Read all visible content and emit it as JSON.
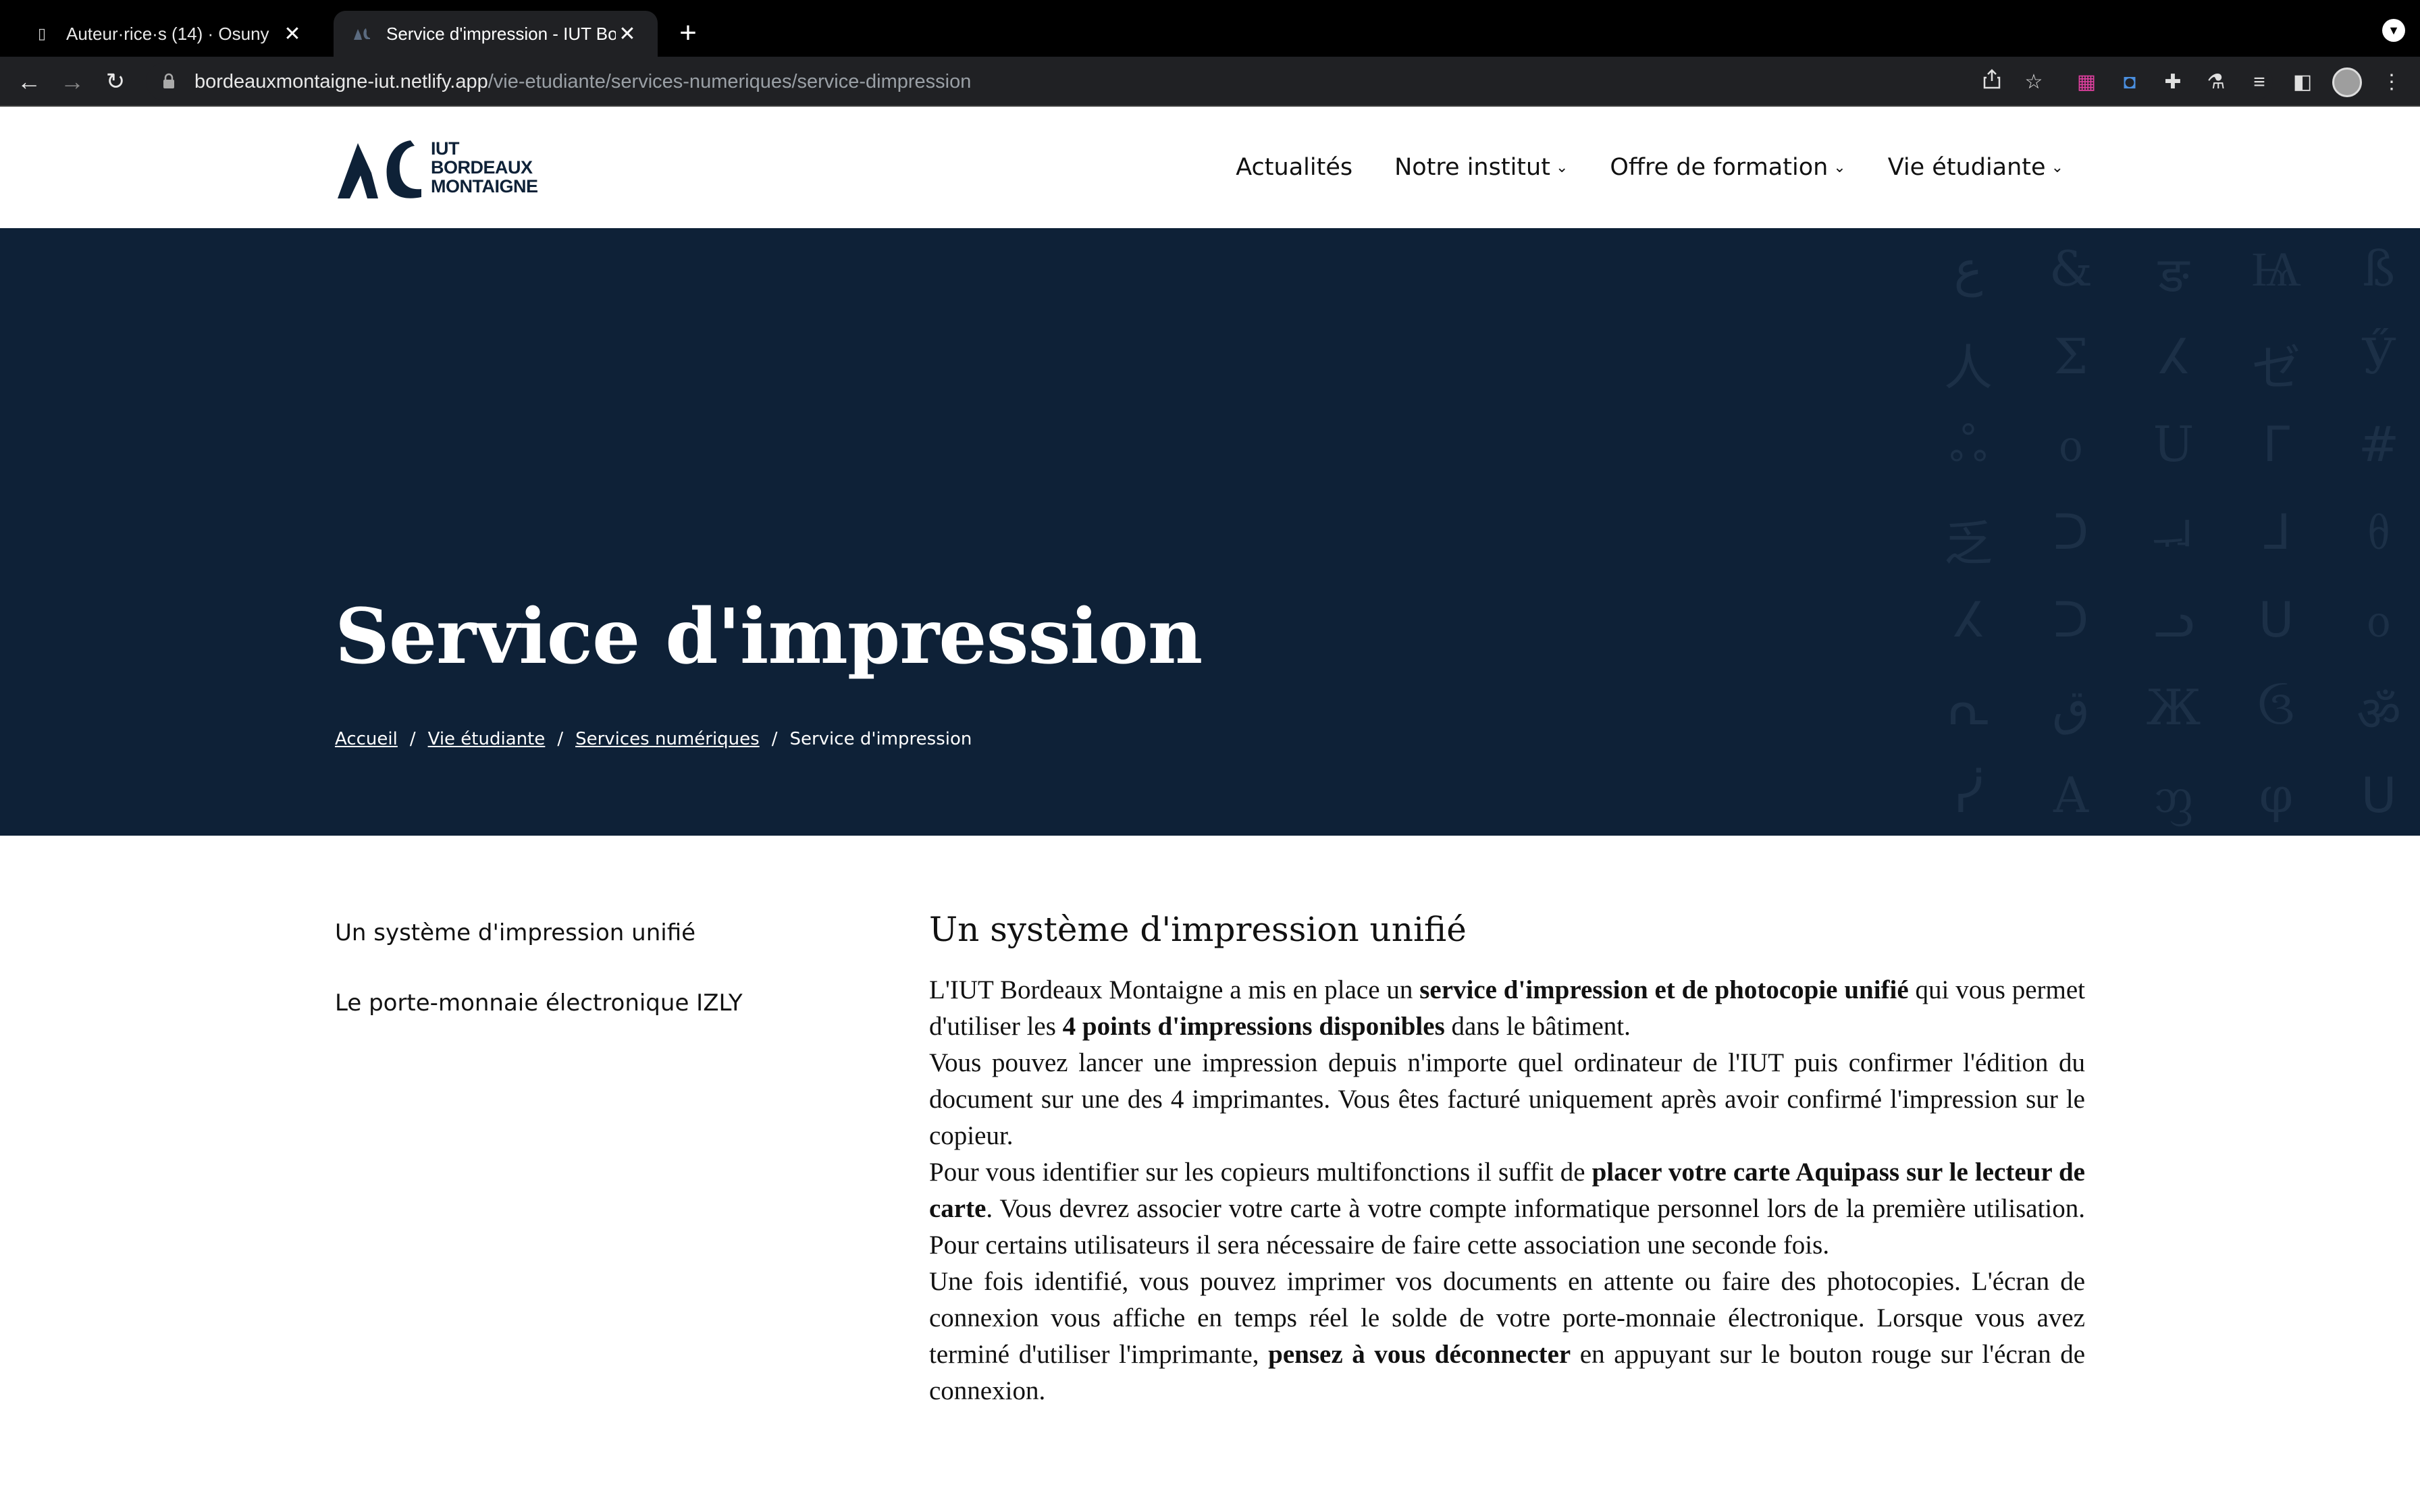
{
  "browser": {
    "tabs": [
      {
        "title": "Auteur·rice·s (14) · Osuny",
        "active": false
      },
      {
        "title": "Service d'impression - IUT Bordeaux Montaigne",
        "active": true
      }
    ],
    "url_host": "bordeauxmontaigne-iut.netlify.app",
    "url_path": "/vie-etudiante/services-numeriques/service-dimpression"
  },
  "site": {
    "logo_lines": [
      "IUT",
      "BORDEAUX",
      "MONTAIGNE"
    ],
    "nav": [
      {
        "label": "Actualités",
        "dropdown": false
      },
      {
        "label": "Notre institut",
        "dropdown": true
      },
      {
        "label": "Offre de formation",
        "dropdown": true
      },
      {
        "label": "Vie étudiante",
        "dropdown": true
      }
    ]
  },
  "hero": {
    "title": "Service d'impression",
    "breadcrumb": [
      {
        "label": "Accueil",
        "link": true
      },
      {
        "label": "Vie étudiante",
        "link": true
      },
      {
        "label": "Services numériques",
        "link": true
      },
      {
        "label": "Service d'impression",
        "link": false
      }
    ],
    "glyphs": [
      "ع",
      "&",
      "ङ",
      "Ѩ",
      "ß",
      "人",
      "Σ",
      "ⵃ",
      "ゼ",
      "Ӳ",
      "ஃ",
      "ᦞ",
      "U",
      "ᒥ",
      "#",
      "乏",
      "ᑐ",
      "ᅯ",
      "ᒧ",
      "ᦲ",
      "ⵃ",
      "ᑐ",
      "ᓗ",
      "ᑌ",
      "ᦞ",
      "ᕆ",
      "ق",
      "Ж",
      "ઉ",
      "ॐ",
      "ᓰ",
      "A",
      "ᦀ",
      "φ",
      "ᑌ"
    ],
    "colors": {
      "background": "#0e2137",
      "glyph": "#1c3047"
    }
  },
  "toc": [
    "Un système d'impression unifié",
    "Le porte-monnaie électronique IZLY"
  ],
  "article": {
    "heading": "Un système d'impression unifié",
    "p1": {
      "a": "L'IUT Bordeaux Montaigne a mis en place un ",
      "b": "service d'impression et de photocopie unifié",
      "c": " qui vous permet d'utiliser les ",
      "d": "4 points d'impressions disponibles",
      "e": " dans le bâtiment."
    },
    "p2": "Vous pouvez lancer une impression depuis n'importe quel ordinateur de l'IUT puis confirmer l'édition du document sur une des 4 imprimantes. Vous êtes facturé uniquement après avoir confirmé l'impression sur le copieur.",
    "p3": {
      "a": "Pour vous identifier sur les copieurs multifonctions il suffit de ",
      "b": "placer votre carte Aquipass sur le lecteur de carte",
      "c": ". Vous devrez associer votre carte à votre compte informatique personnel lors de la première utilisation. Pour certains utilisateurs il sera nécessaire de faire cette association une seconde fois."
    },
    "p4": {
      "a": "Une fois identifié, vous pouvez imprimer vos documents en attente ou faire des photocopies. L'écran de connexion vous affiche en temps réel le solde de votre porte-monnaie électronique. Lorsque vous avez terminé d'utiliser l'imprimante, ",
      "b": "pensez à vous déconnecter",
      "c": " en appuyant sur le bouton rouge sur l'écran de connexion."
    }
  }
}
